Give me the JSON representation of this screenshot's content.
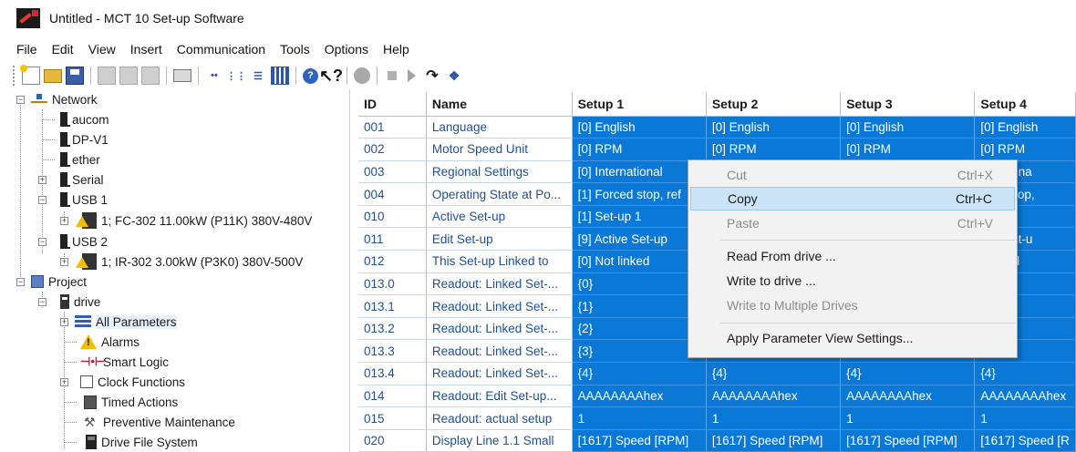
{
  "window": {
    "title": "Untitled - MCT 10 Set-up Software"
  },
  "menu": [
    "File",
    "Edit",
    "View",
    "Insert",
    "Communication",
    "Tools",
    "Options",
    "Help"
  ],
  "toolbar": {
    "icons": [
      "new-icon",
      "open-icon",
      "save-icon",
      "cut-icon",
      "copy-icon",
      "paste-icon",
      "print-icon",
      "network-scan-icon",
      "tree-icon",
      "list-view-icon",
      "grid-view-icon",
      "help-icon",
      "whats-this-icon",
      "record-icon",
      "stop-icon",
      "play-icon",
      "read-drive-icon",
      "write-drive-icon"
    ]
  },
  "tree": {
    "items": [
      {
        "label": "Network"
      },
      {
        "label": "aucom"
      },
      {
        "label": "DP-V1"
      },
      {
        "label": "ether"
      },
      {
        "label": "Serial"
      },
      {
        "label": "USB 1"
      },
      {
        "label": "1; FC-302 11.00kW (P11K) 380V-480V"
      },
      {
        "label": "USB 2"
      },
      {
        "label": "1; IR-302 3.00kW (P3K0) 380V-500V"
      },
      {
        "label": "Project"
      },
      {
        "label": "drive"
      },
      {
        "label": "All Parameters"
      },
      {
        "label": "Alarms"
      },
      {
        "label": "Smart Logic"
      },
      {
        "label": "Clock Functions"
      },
      {
        "label": "Timed Actions"
      },
      {
        "label": "Preventive Maintenance"
      },
      {
        "label": "Drive File System"
      }
    ]
  },
  "grid": {
    "headers": [
      "ID",
      "Name",
      "Setup 1",
      "Setup 2",
      "Setup 3",
      "Setup 4"
    ],
    "rows": [
      {
        "id": "001",
        "name": "Language",
        "s1": "[0] English",
        "s2": "[0] English",
        "s3": "[0] English",
        "s4": "[0] English"
      },
      {
        "id": "002",
        "name": "Motor Speed Unit",
        "s1": "[0] RPM",
        "s2": "[0] RPM",
        "s3": "[0] RPM",
        "s4": "[0] RPM"
      },
      {
        "id": "003",
        "name": "Regional Settings",
        "s1": "[0] International",
        "s2": "",
        "s3": "",
        "s4": "ernationa"
      },
      {
        "id": "004",
        "name": "Operating State at Po...",
        "s1": "[1] Forced stop, ref",
        "s2": "",
        "s3": "",
        "s4": "rced stop,"
      },
      {
        "id": "010",
        "name": "Active Set-up",
        "s1": "[1] Set-up 1",
        "s2": "",
        "s3": "",
        "s4": "-up 1"
      },
      {
        "id": "011",
        "name": "Edit Set-up",
        "s1": "[9] Active Set-up",
        "s2": "",
        "s3": "",
        "s4": "tive Set-u"
      },
      {
        "id": "012",
        "name": "This Set-up Linked to",
        "s1": "[0] Not linked",
        "s2": "",
        "s3": "",
        "s4": "t linked"
      },
      {
        "id": "013.0",
        "name": "Readout: Linked Set-...",
        "s1": "{0}",
        "s2": "",
        "s3": "",
        "s4": ""
      },
      {
        "id": "013.1",
        "name": "Readout: Linked Set-...",
        "s1": "{1}",
        "s2": "",
        "s3": "",
        "s4": ""
      },
      {
        "id": "013.2",
        "name": "Readout: Linked Set-...",
        "s1": "{2}",
        "s2": "",
        "s3": "",
        "s4": ""
      },
      {
        "id": "013.3",
        "name": "Readout: Linked Set-...",
        "s1": "{3}",
        "s2": "",
        "s3": "",
        "s4": ""
      },
      {
        "id": "013.4",
        "name": "Readout: Linked Set-...",
        "s1": "{4}",
        "s2": "{4}",
        "s3": "{4}",
        "s4": "{4}"
      },
      {
        "id": "014",
        "name": "Readout: Edit Set-up...",
        "s1": "AAAAAAAAhex",
        "s2": "AAAAAAAAhex",
        "s3": "AAAAAAAAhex",
        "s4": "AAAAAAAAhex"
      },
      {
        "id": "015",
        "name": "Readout: actual setup",
        "s1": "1",
        "s2": "1",
        "s3": "1",
        "s4": "1"
      },
      {
        "id": "020",
        "name": "Display Line 1.1 Small",
        "s1": "[1617] Speed [RPM]",
        "s2": "[1617] Speed [RPM]",
        "s3": "[1617] Speed [RPM]",
        "s4": "[1617] Speed [R"
      }
    ]
  },
  "context_menu": {
    "items": [
      {
        "label": "Cut",
        "shortcut": "Ctrl+X",
        "disabled": true
      },
      {
        "label": "Copy",
        "shortcut": "Ctrl+C",
        "disabled": false,
        "hover": true
      },
      {
        "label": "Paste",
        "shortcut": "Ctrl+V",
        "disabled": true
      },
      {
        "label": "Read From drive ...",
        "shortcut": "",
        "disabled": false
      },
      {
        "label": "Write to drive ...",
        "shortcut": "",
        "disabled": false
      },
      {
        "label": "Write to Multiple Drives",
        "shortcut": "",
        "disabled": true
      },
      {
        "label": "Apply Parameter View Settings...",
        "shortcut": "",
        "disabled": false
      }
    ]
  },
  "colors": {
    "selection": "#0a78d7",
    "menu_hover": "#cce4f7",
    "link_text": "#1e4f9a"
  }
}
